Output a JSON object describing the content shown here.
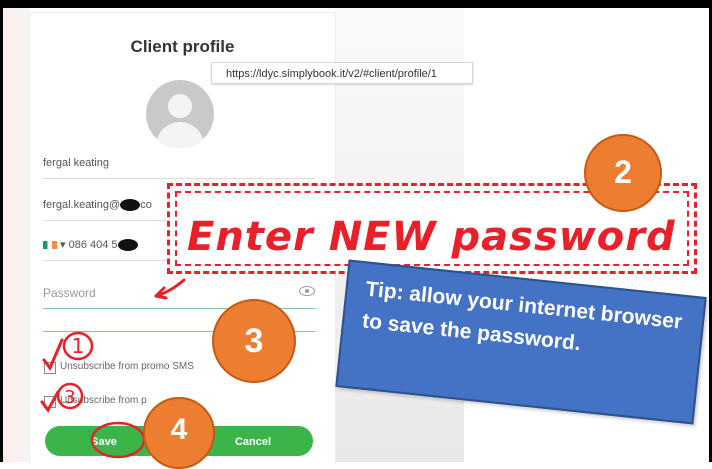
{
  "panel": {
    "title": "Client profile"
  },
  "browser": {
    "url": "https://ldyc.simplybook.it/v2/#client/profile/1"
  },
  "form": {
    "name": "fergal keating",
    "email": "fergal.keating@",
    "email_suffix": "co",
    "phone_prefix": "▾ 086 404 5",
    "password_placeholder": "Password",
    "promo_sms_label": "Unsubscribe from promo SMS",
    "promo_email_label": "Unsubscribe from p",
    "save_label": "Save",
    "cancel_label": "Cancel"
  },
  "annotations": {
    "step2": "2",
    "step3": "3",
    "step4": "4",
    "step1_hand": "1",
    "step3_hand": "3",
    "enter_password": "Enter NEW password",
    "tip": "Tip: allow your internet browser to save the password."
  },
  "colors": {
    "accent_green": "#3bb54a",
    "annotation_orange": "#ed7d31",
    "annotation_red": "#e8202a",
    "tip_blue": "#4472c4"
  },
  "icons": {
    "avatar": "user-avatar-icon",
    "eye": "eye-icon",
    "flag": "ireland-flag-icon"
  }
}
